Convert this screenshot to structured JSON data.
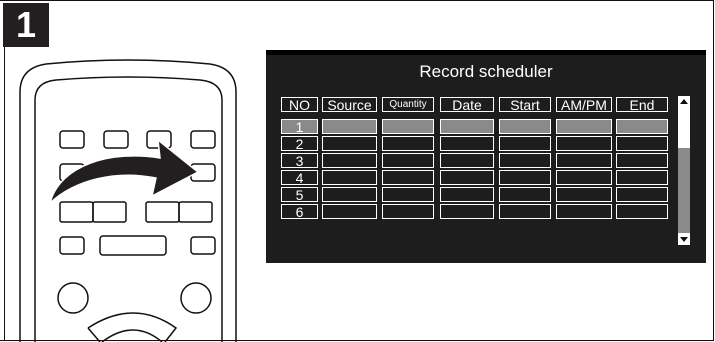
{
  "step": {
    "number": "1"
  },
  "screen": {
    "title": "Record scheduler",
    "columns": [
      "NO",
      "Source",
      "Quantity",
      "Date",
      "Start",
      "AM/PM",
      "End"
    ],
    "rows": [
      {
        "no": "1",
        "selected": true
      },
      {
        "no": "2",
        "selected": false
      },
      {
        "no": "3",
        "selected": false
      },
      {
        "no": "4",
        "selected": false
      },
      {
        "no": "5",
        "selected": false
      },
      {
        "no": "6",
        "selected": false
      }
    ],
    "scrollbar": {
      "up_icon": "triangle-up-icon",
      "down_icon": "triangle-down-icon"
    }
  },
  "colors": {
    "screen_bg": "#1d1d1d",
    "highlight": "#8a8a8a",
    "text": "#ffffff",
    "badge_bg": "#231f20"
  },
  "illustration": {
    "remote_icon": "remote-control-icon",
    "arrow_icon": "curved-arrow-icon"
  }
}
